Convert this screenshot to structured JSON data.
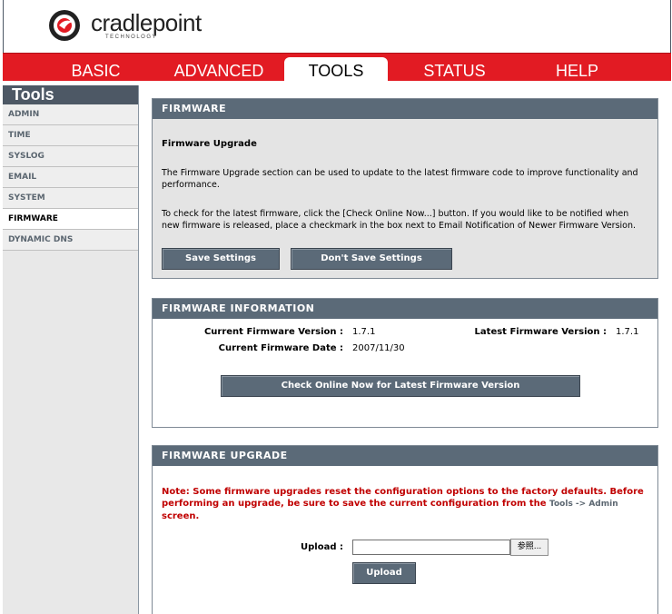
{
  "brand": {
    "name": "cradlepoint",
    "sub": "TECHNOLOGY"
  },
  "nav": {
    "tabs": [
      "BASIC",
      "ADVANCED",
      "TOOLS",
      "STATUS",
      "HELP"
    ],
    "active": "TOOLS"
  },
  "sidebar": {
    "title": "Tools",
    "items": [
      "ADMIN",
      "TIME",
      "SYSLOG",
      "EMAIL",
      "SYSTEM",
      "FIRMWARE",
      "DYNAMIC DNS"
    ],
    "active": "FIRMWARE"
  },
  "firmware": {
    "heading": "FIRMWARE",
    "subtitle": "Firmware Upgrade",
    "para1": "The Firmware Upgrade section can be used to update to the latest firmware code to improve functionality and performance.",
    "para2": "To check for the latest firmware, click the [Check Online Now...] button. If you would like to be notified when new firmware is released, place a checkmark in the box next to Email Notification of Newer Firmware Version.",
    "save_label": "Save Settings",
    "dont_save_label": "Don't Save Settings"
  },
  "info": {
    "heading": "FIRMWARE INFORMATION",
    "current_version_label": "Current Firmware Version :",
    "current_version": "1.7.1",
    "latest_version_label": "Latest Firmware Version :",
    "latest_version": "1.7.1",
    "current_date_label": "Current Firmware Date :",
    "current_date": "2007/11/30",
    "check_label": "Check Online Now for Latest Firmware Version"
  },
  "upgrade": {
    "heading": "FIRMWARE UPGRADE",
    "note_pre": "Note: Some firmware upgrades reset the configuration options to the factory defaults. Before performing an upgrade, be sure to save the current configuration from the ",
    "note_link": "Tools -> Admin",
    "note_post": "screen.",
    "upload_label": "Upload :",
    "file_value": "",
    "browse_label": "参照...",
    "upload_button": "Upload"
  },
  "colors": {
    "nav_red": "#e21b23",
    "panel_head": "#5b6a78",
    "note_red": "#c00000"
  }
}
